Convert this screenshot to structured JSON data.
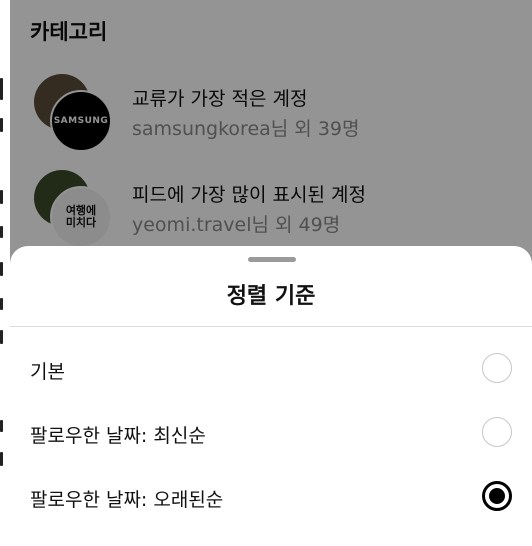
{
  "category": {
    "title": "카테고리",
    "items": [
      {
        "title": "교류가 가장 적은 계정",
        "account": "samsungkorea",
        "suffix": "님 외 39명",
        "front_avatar_text": "SAMSUNG",
        "icon": "samsung-avatar"
      },
      {
        "title": "피드에 가장 많이 표시된 계정",
        "account": "yeomi.travel",
        "suffix": "님 외 49명",
        "front_avatar_text": "여행에\n미치다",
        "icon": "yeomi-avatar"
      }
    ]
  },
  "sort_sheet": {
    "title": "정렬 기준",
    "options": [
      {
        "label": "기본",
        "selected": false
      },
      {
        "label": "팔로우한 날짜: 최신순",
        "selected": false
      },
      {
        "label": "팔로우한 날짜: 오래된순",
        "selected": true
      }
    ]
  },
  "colors": {
    "overlay": "rgba(0,0,0,0.42)",
    "selected_radio": "#000000",
    "secondary_text": "#8a8a8a"
  }
}
